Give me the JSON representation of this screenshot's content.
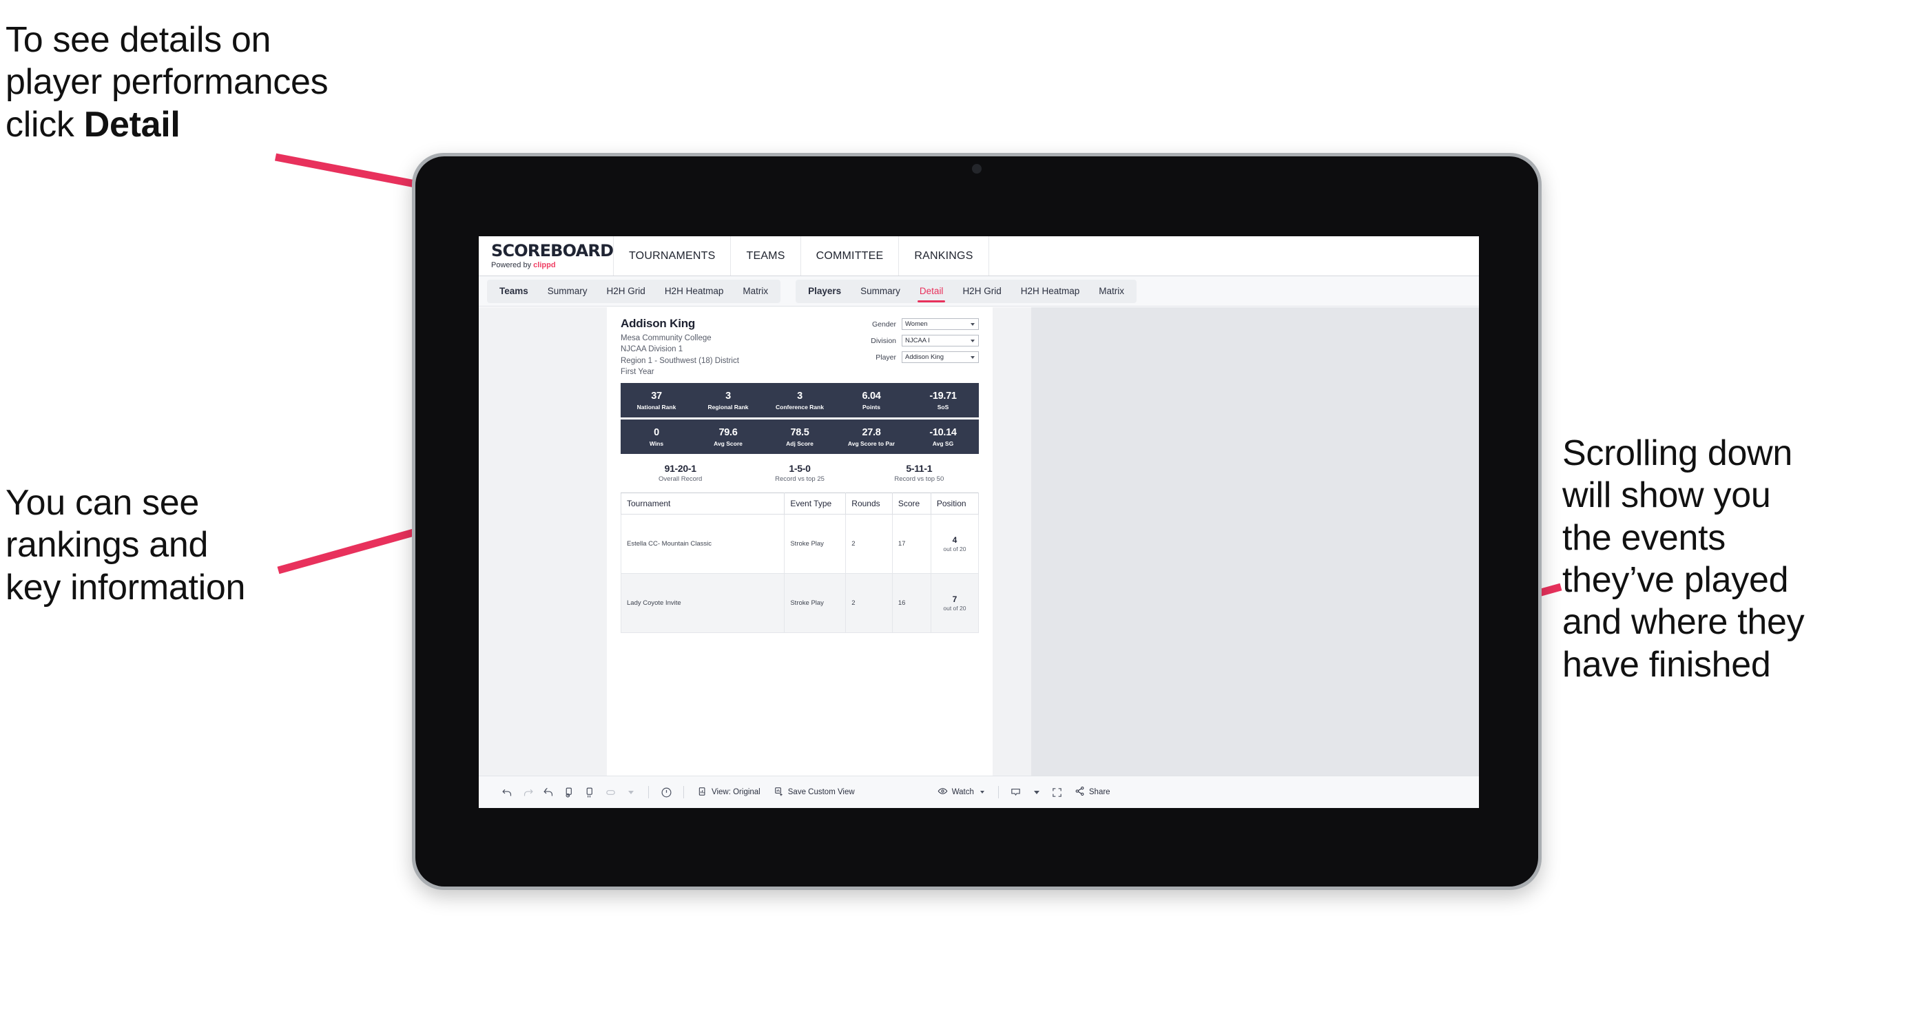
{
  "annotations": {
    "detail": "To see details on\nplayer performances\nclick ",
    "detail_bold": "Detail",
    "rankings": "You can see\nrankings and\nkey information",
    "scrolling": "Scrolling down\nwill show you\nthe events\nthey’ve played\nand where they\nhave finished",
    "arrow_color": "#e8315c"
  },
  "app": {
    "brand": {
      "title": "SCOREBOARD",
      "powered_prefix": "Powered by ",
      "powered_name": "clippd"
    },
    "topnav": [
      {
        "label": "TOURNAMENTS"
      },
      {
        "label": "TEAMS"
      },
      {
        "label": "COMMITTEE"
      },
      {
        "label": "RANKINGS"
      }
    ],
    "subnav": {
      "group_teams": [
        {
          "label": "Teams",
          "head": true,
          "active": false
        },
        {
          "label": "Summary",
          "head": false,
          "active": false
        },
        {
          "label": "H2H Grid",
          "head": false,
          "active": false
        },
        {
          "label": "H2H Heatmap",
          "head": false,
          "active": false
        },
        {
          "label": "Matrix",
          "head": false,
          "active": false
        }
      ],
      "group_players": [
        {
          "label": "Players",
          "head": true,
          "active": false
        },
        {
          "label": "Summary",
          "head": false,
          "active": false
        },
        {
          "label": "Detail",
          "head": false,
          "active": true
        },
        {
          "label": "H2H Grid",
          "head": false,
          "active": false
        },
        {
          "label": "H2H Heatmap",
          "head": false,
          "active": false
        },
        {
          "label": "Matrix",
          "head": false,
          "active": false
        }
      ]
    }
  },
  "player": {
    "name": "Addison King",
    "school": "Mesa Community College",
    "division": "NJCAA Division 1",
    "region": "Region 1 - Southwest (18) District",
    "year": "First Year"
  },
  "filters": [
    {
      "label": "Gender",
      "value": "Women"
    },
    {
      "label": "Division",
      "value": "NJCAA I"
    },
    {
      "label": "Player",
      "value": "Addison King"
    }
  ],
  "stats_row1": [
    {
      "value": "37",
      "label": "National Rank"
    },
    {
      "value": "3",
      "label": "Regional Rank"
    },
    {
      "value": "3",
      "label": "Conference Rank"
    },
    {
      "value": "6.04",
      "label": "Points"
    },
    {
      "value": "-19.71",
      "label": "SoS"
    }
  ],
  "stats_row2": [
    {
      "value": "0",
      "label": "Wins"
    },
    {
      "value": "79.6",
      "label": "Avg Score"
    },
    {
      "value": "78.5",
      "label": "Adj Score"
    },
    {
      "value": "27.8",
      "label": "Avg Score to Par"
    },
    {
      "value": "-10.14",
      "label": "Avg SG"
    }
  ],
  "records": [
    {
      "value": "91-20-1",
      "label": "Overall Record"
    },
    {
      "value": "1-5-0",
      "label": "Record vs top 25"
    },
    {
      "value": "5-11-1",
      "label": "Record vs top 50"
    }
  ],
  "table": {
    "columns": [
      "Tournament",
      "Event Type",
      "Rounds",
      "Score",
      "Position"
    ],
    "rows": [
      {
        "tournament": "Estella CC- Mountain Classic",
        "event_type": "Stroke Play",
        "rounds": "2",
        "score": "17",
        "position": "4",
        "position_sub": "out of 20"
      },
      {
        "tournament": "Lady Coyote Invite",
        "event_type": "Stroke Play",
        "rounds": "2",
        "score": "16",
        "position": "7",
        "position_sub": "out of 20"
      }
    ]
  },
  "toolbar": {
    "view_label": "View: Original",
    "save_label": "Save Custom View",
    "watch_label": "Watch",
    "share_label": "Share",
    "icons": [
      "undo-icon",
      "redo-icon",
      "revert-icon",
      "refresh-data-icon",
      "pause-icon",
      "pill-icon"
    ]
  },
  "colors": {
    "accent": "#e8315c",
    "stat_bar": "#333a4e",
    "app_bg": "#e4e6ea"
  }
}
